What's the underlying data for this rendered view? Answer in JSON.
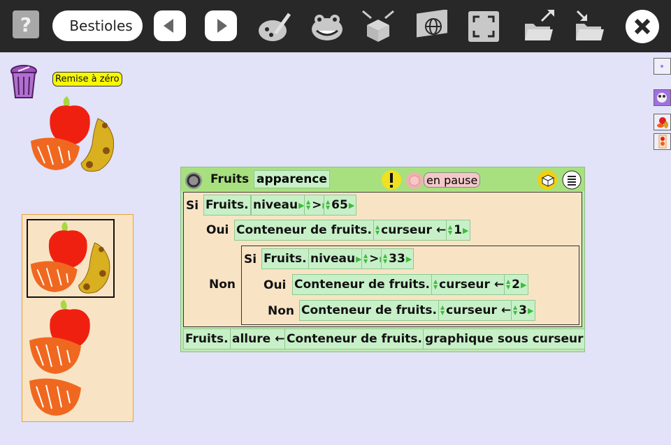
{
  "toolbar": {
    "help_label": "?",
    "title": "Bestioles",
    "icons": [
      "back-icon",
      "forward-icon",
      "paint-icon",
      "frog-icon",
      "box-icon",
      "globe-icon",
      "fullscreen-icon",
      "open-folder-icon",
      "save-folder-icon",
      "close-icon"
    ]
  },
  "workspace": {
    "reset_label": "Remise à zéro"
  },
  "robot": {
    "name": "Fruits",
    "costume": "apparence",
    "status": "en pause",
    "cond1": {
      "si": "Si",
      "obj": "Fruits.",
      "prop": "niveau",
      "op": ">",
      "value": "65"
    },
    "oui1": {
      "label": "Oui",
      "obj": "Conteneur de fruits.",
      "prop": "curseur",
      "value": "1"
    },
    "non1": {
      "label": "Non"
    },
    "cond2": {
      "si": "Si",
      "obj": "Fruits.",
      "prop": "niveau",
      "op": ">",
      "value": "33"
    },
    "oui2": {
      "label": "Oui",
      "obj": "Conteneur de fruits.",
      "prop": "curseur",
      "value": "2"
    },
    "non2": {
      "label": "Non",
      "obj": "Conteneur de fruits.",
      "prop": "curseur",
      "value": "3"
    },
    "action": {
      "obj": "Fruits.",
      "prop": "allure",
      "src": "Conteneur de fruits.",
      "src_prop": "graphique sous curseur"
    }
  },
  "colors": {
    "toolbar": "#282828",
    "background": "#e2e2f8",
    "tile": "#c8f0c8",
    "header": "#a8e080",
    "body": "#f8e4c4",
    "reset": "#f8f800"
  }
}
